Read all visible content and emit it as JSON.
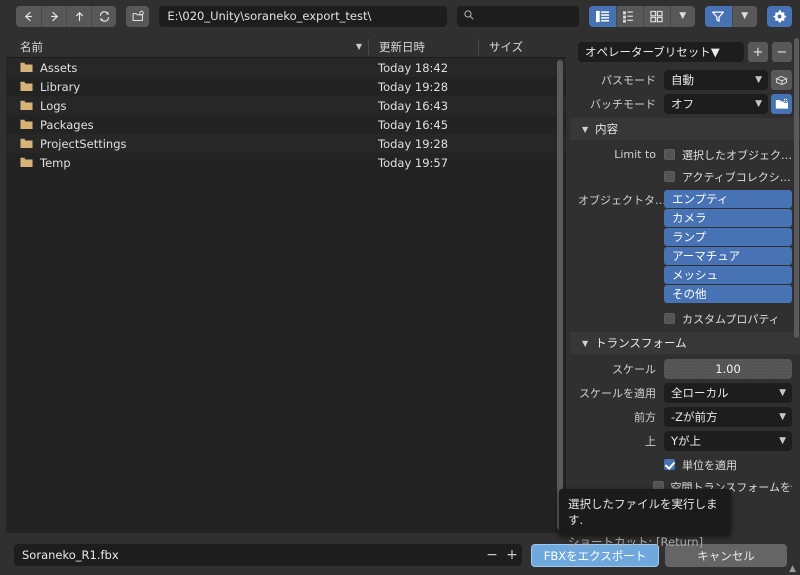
{
  "toolbar": {
    "nav": [
      {
        "name": "back",
        "glyph": "←"
      },
      {
        "name": "forward",
        "glyph": "→"
      },
      {
        "name": "up",
        "glyph": "↑"
      },
      {
        "name": "refresh",
        "glyph": "⟳"
      }
    ],
    "new_folder_tooltip": "",
    "path_value": "E:\\020_Unity\\soraneko_export_test\\",
    "search_placeholder": "",
    "search_value": "",
    "display_modes": [
      "vertical-list",
      "horizontal-list",
      "thumbnails"
    ],
    "active_display_mode": 0
  },
  "filelist": {
    "columns": [
      "名前",
      "更新日時",
      "サイズ"
    ],
    "rows": [
      {
        "name": "Assets",
        "date": "Today 18:42",
        "size": ""
      },
      {
        "name": "Library",
        "date": "Today 19:28",
        "size": ""
      },
      {
        "name": "Logs",
        "date": "Today 16:43",
        "size": ""
      },
      {
        "name": "Packages",
        "date": "Today 16:45",
        "size": ""
      },
      {
        "name": "ProjectSettings",
        "date": "Today 19:28",
        "size": ""
      },
      {
        "name": "Temp",
        "date": "Today 19:57",
        "size": ""
      }
    ]
  },
  "panel": {
    "preset_label": "オペレーターブリセット",
    "preset_add": "+",
    "preset_remove": "−",
    "path_mode_label": "パスモード",
    "path_mode_value": "自動",
    "batch_mode_label": "バッチモード",
    "batch_mode_value": "オフ",
    "content_section": "内容",
    "limit_to_label": "Limit to",
    "limit_options": [
      {
        "label": "選択したオブジェク…",
        "checked": false
      },
      {
        "label": "アクティブコレクシ…",
        "checked": false
      }
    ],
    "object_types_label": "オブジェクトタ…",
    "object_types": [
      "エンプティ",
      "カメラ",
      "ランプ",
      "アーマチュア",
      "メッシュ",
      "その他"
    ],
    "custom_props_label": "カスタムプロパティ",
    "custom_props_checked": false,
    "transform_section": "トランスフォーム",
    "scale_label": "スケール",
    "scale_value": "1.00",
    "apply_scale_label": "スケールを適用",
    "apply_scale_value": "全ローカル",
    "forward_label": "前方",
    "forward_value": "-Zが前方",
    "up_label": "上",
    "up_value": "Yが上",
    "apply_unit_label": "単位を適用",
    "apply_unit_checked": true,
    "space_transform_label": "空間トランスフォームを使用",
    "space_transform_tail": "ムを使用",
    "space_transform_checked": false
  },
  "tooltip": {
    "line1": "選択したファイルを実行します.",
    "line2": "ショートカット: [Return]"
  },
  "bottom": {
    "filename": "Soraneko_R1.fbx",
    "minus": "−",
    "plus": "+",
    "export_label": "FBXをエクスポート",
    "cancel_label": "キャンセル"
  },
  "colors": {
    "accent": "#4772b3",
    "accent_hover": "#6fa8dc",
    "folder": "#d7b377",
    "panel_bg": "#303030",
    "list_bg": "#232323",
    "field_bg": "#1d1d1d"
  }
}
